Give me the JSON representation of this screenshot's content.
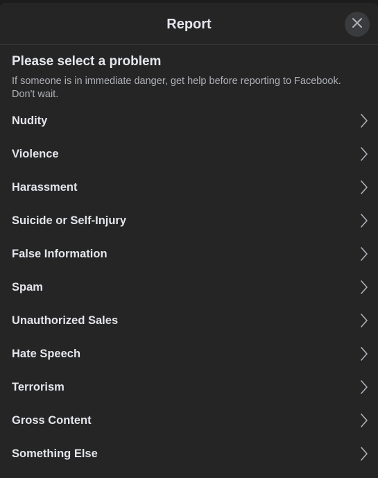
{
  "dialog": {
    "title": "Report",
    "close_icon": "close-icon"
  },
  "intro": {
    "heading": "Please select a problem",
    "description": "If someone is in immediate danger, get help before reporting to Facebook. Don't wait."
  },
  "problems": [
    {
      "label": "Nudity",
      "icon": "chevron-right-icon"
    },
    {
      "label": "Violence",
      "icon": "chevron-right-icon"
    },
    {
      "label": "Harassment",
      "icon": "chevron-right-icon"
    },
    {
      "label": "Suicide or Self-Injury",
      "icon": "chevron-right-icon"
    },
    {
      "label": "False Information",
      "icon": "chevron-right-icon"
    },
    {
      "label": "Spam",
      "icon": "chevron-right-icon"
    },
    {
      "label": "Unauthorized Sales",
      "icon": "chevron-right-icon"
    },
    {
      "label": "Hate Speech",
      "icon": "chevron-right-icon"
    },
    {
      "label": "Terrorism",
      "icon": "chevron-right-icon"
    },
    {
      "label": "Gross Content",
      "icon": "chevron-right-icon"
    },
    {
      "label": "Something Else",
      "icon": "chevron-right-icon"
    }
  ],
  "colors": {
    "background": "#252526",
    "text_primary": "#e4e6eb",
    "text_secondary": "#b0b3b8",
    "close_button_bg": "#3a3b3c"
  }
}
